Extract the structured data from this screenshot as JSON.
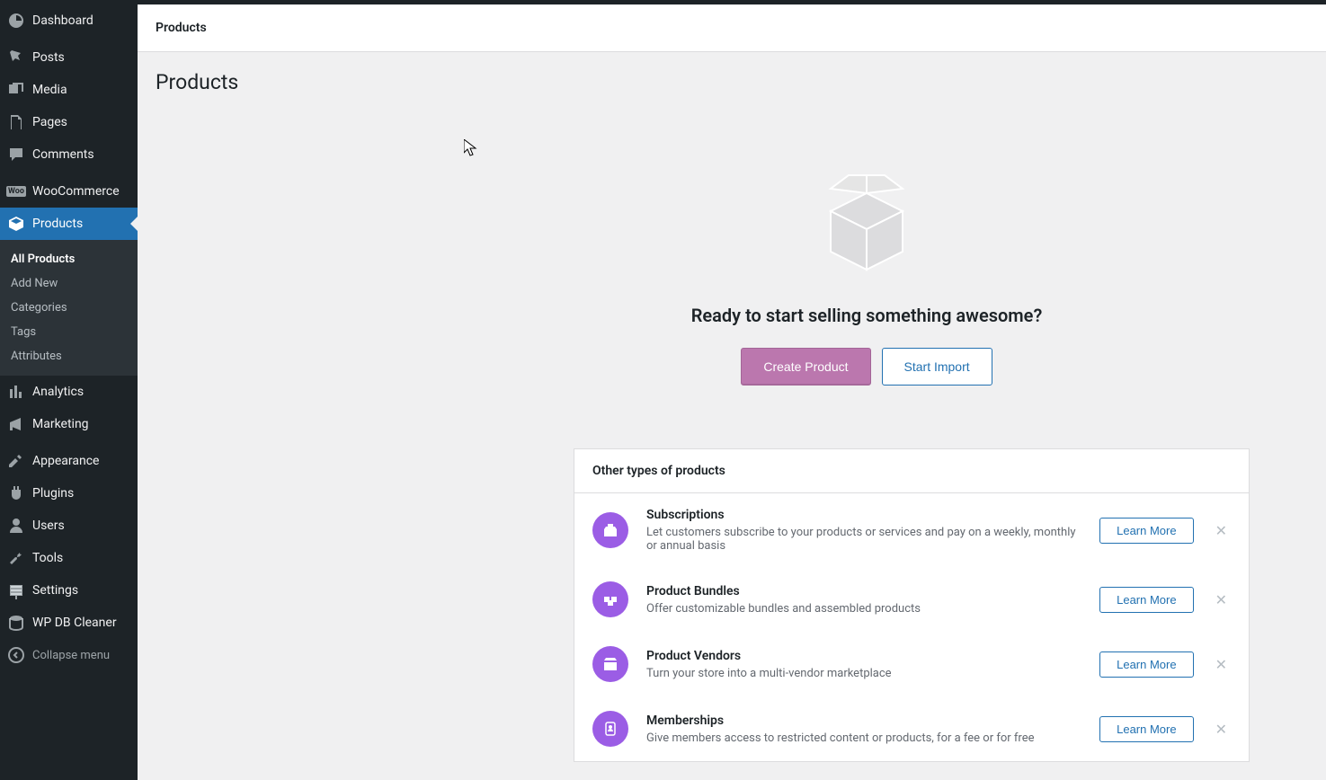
{
  "sidebar": {
    "items": [
      {
        "label": "Dashboard"
      },
      {
        "label": "Posts"
      },
      {
        "label": "Media"
      },
      {
        "label": "Pages"
      },
      {
        "label": "Comments"
      },
      {
        "label": "WooCommerce"
      },
      {
        "label": "Products"
      },
      {
        "label": "Analytics"
      },
      {
        "label": "Marketing"
      },
      {
        "label": "Appearance"
      },
      {
        "label": "Plugins"
      },
      {
        "label": "Users"
      },
      {
        "label": "Tools"
      },
      {
        "label": "Settings"
      },
      {
        "label": "WP DB Cleaner"
      }
    ],
    "submenu": [
      {
        "label": "All Products"
      },
      {
        "label": "Add New"
      },
      {
        "label": "Categories"
      },
      {
        "label": "Tags"
      },
      {
        "label": "Attributes"
      }
    ],
    "collapse_label": "Collapse menu"
  },
  "header": {
    "title": "Products"
  },
  "page": {
    "title": "Products",
    "hero_title": "Ready to start selling something awesome?",
    "create_btn": "Create Product",
    "import_btn": "Start Import"
  },
  "panel": {
    "title": "Other types of products",
    "learn_more": "Learn More",
    "rows": [
      {
        "title": "Subscriptions",
        "desc": "Let customers subscribe to your products or services and pay on a weekly, monthly or annual basis"
      },
      {
        "title": "Product Bundles",
        "desc": "Offer customizable bundles and assembled products"
      },
      {
        "title": "Product Vendors",
        "desc": "Turn your store into a multi-vendor marketplace"
      },
      {
        "title": "Memberships",
        "desc": "Give members access to restricted content or products, for a fee or for free"
      }
    ]
  },
  "close_glyph": "✕"
}
